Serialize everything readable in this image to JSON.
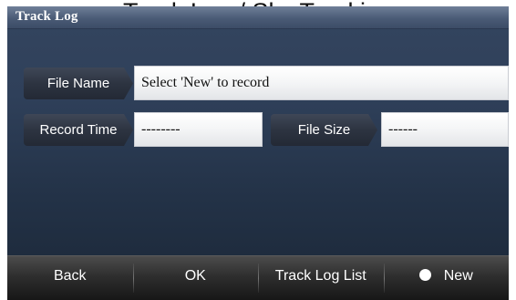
{
  "caption": "Track Log / Sky Tracking",
  "window": {
    "title": "Track Log"
  },
  "form": {
    "file_name_label": "File Name",
    "file_name_value": "Select 'New' to record",
    "record_time_label": "Record Time",
    "record_time_value": "--------",
    "file_size_label": "File Size",
    "file_size_value": "------"
  },
  "toolbar": {
    "back_label": "Back",
    "ok_label": "OK",
    "track_log_list_label": "Track Log List",
    "new_label": "New"
  },
  "icons": {
    "new_indicator": "filled-circle-icon"
  },
  "colors": {
    "toolbar_background": "#2e2e2e",
    "field_background": "#ffffff",
    "screen_background": "#2f405a"
  }
}
